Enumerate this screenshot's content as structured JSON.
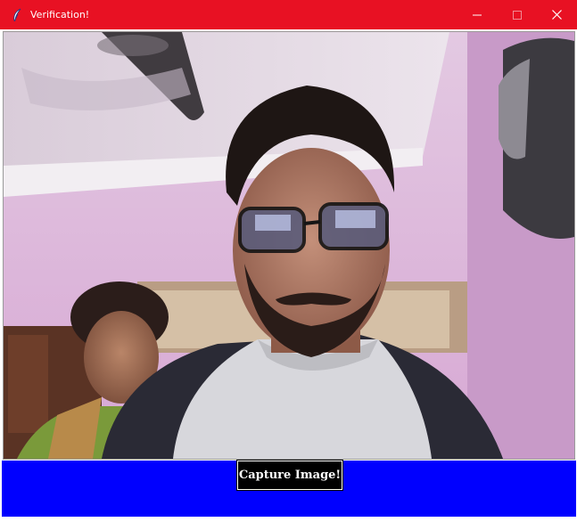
{
  "window": {
    "title": "Verification!",
    "title_bar_color": "#e81123",
    "app_icon": "feather-icon",
    "caption_buttons": [
      "minimize-icon",
      "maximize-icon",
      "close-icon"
    ]
  },
  "camera_feed": {
    "kind": "live-webcam-preview"
  },
  "controls": {
    "background_color": "#0000ff",
    "capture_label": "Capture Image!"
  }
}
